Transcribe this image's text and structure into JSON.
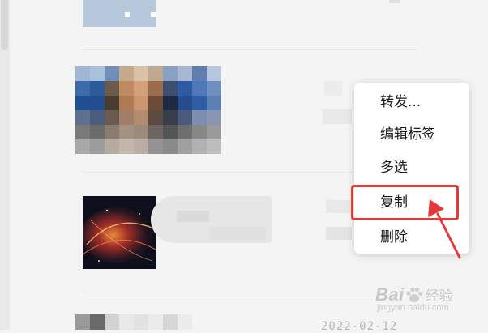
{
  "context_menu": {
    "items": [
      {
        "label": "转发..."
      },
      {
        "label": "编辑标签"
      },
      {
        "label": "多选"
      },
      {
        "label": "复制"
      },
      {
        "label": "删除"
      }
    ],
    "highlighted_item": "复制"
  },
  "annotation": {
    "color": "#e53935",
    "arrow_target": "复制"
  },
  "watermark": {
    "brand": "Bai",
    "brand2": "经验",
    "url": "jingyan.baidu.com"
  },
  "chat": {
    "partial_timestamp": "2022-02-12"
  }
}
